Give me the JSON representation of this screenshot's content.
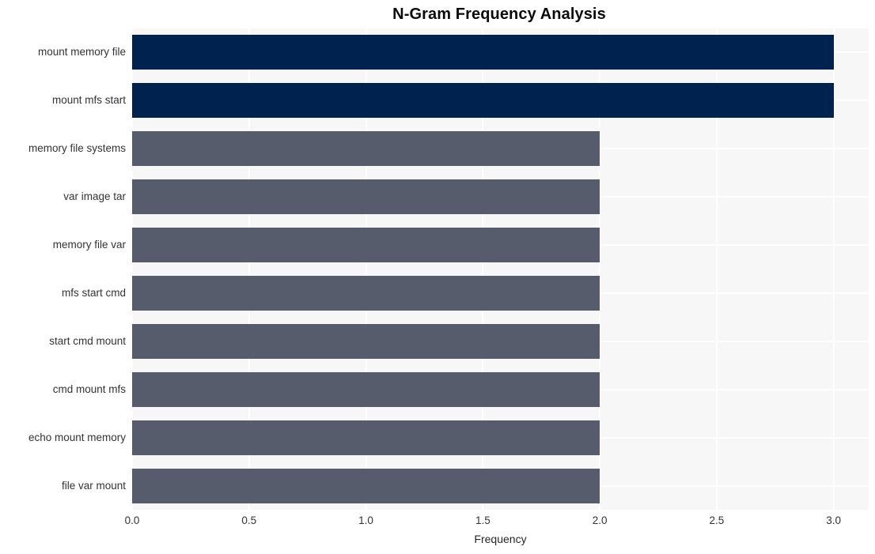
{
  "chart_data": {
    "type": "bar",
    "orientation": "horizontal",
    "title": "N-Gram Frequency Analysis",
    "xlabel": "Frequency",
    "ylabel": "",
    "categories": [
      "mount memory file",
      "mount mfs start",
      "memory file systems",
      "var image tar",
      "memory file var",
      "mfs start cmd",
      "start cmd mount",
      "cmd mount mfs",
      "echo mount memory",
      "file var mount"
    ],
    "values": [
      3,
      3,
      2,
      2,
      2,
      2,
      2,
      2,
      2,
      2
    ],
    "bar_colors": [
      "#00224e",
      "#00224e",
      "#565c6c",
      "#565c6c",
      "#565c6c",
      "#565c6c",
      "#565c6c",
      "#565c6c",
      "#565c6c",
      "#565c6c"
    ],
    "xlim": [
      0,
      3.15
    ],
    "xticks": [
      0,
      0.5,
      1,
      1.5,
      2,
      2.5,
      3
    ],
    "xticklabels": [
      "0.0",
      "0.5",
      "1.0",
      "1.5",
      "2.0",
      "2.5",
      "3.0"
    ],
    "grid": true,
    "grid_color": "#ffffff",
    "plot_background": "#f7f7f8",
    "figure_background": "#ffffff",
    "legend": null
  }
}
